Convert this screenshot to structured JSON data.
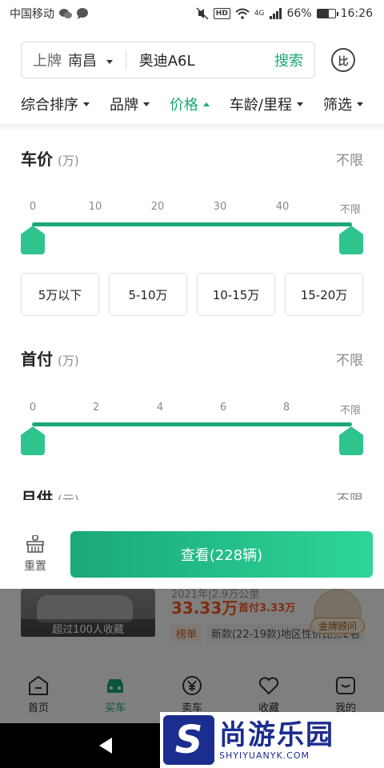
{
  "status_bar": {
    "carrier": "中国移动",
    "hd": "HD",
    "network": "4G",
    "battery": "66%",
    "battery_level": 0.66,
    "time": "16:26"
  },
  "search": {
    "plate_label": "上牌",
    "city": "南昌",
    "query": "奥迪A6L",
    "button": "搜索",
    "compare_icon_text": "比"
  },
  "filters": [
    {
      "label": "综合排序"
    },
    {
      "label": "品牌"
    },
    {
      "label": "价格"
    },
    {
      "label": "车龄/里程"
    },
    {
      "label": "筛选"
    }
  ],
  "price_section": {
    "title": "车价",
    "unit": "(万)",
    "value": "不限",
    "ticks": [
      "0",
      "10",
      "20",
      "30",
      "40",
      "不限"
    ],
    "range": [
      0,
      "不限"
    ],
    "chips": [
      "5万以下",
      "5-10万",
      "10-15万",
      "15-20万"
    ]
  },
  "downpayment_section": {
    "title": "首付",
    "unit": "(万)",
    "value": "不限",
    "ticks": [
      "0",
      "2",
      "4",
      "6",
      "8",
      "不限"
    ],
    "range": [
      0,
      "不限"
    ]
  },
  "monthly_section": {
    "title": "月供",
    "unit": "(元)",
    "value": "不限"
  },
  "actions": {
    "reset": "重置",
    "view": "查看(228辆)"
  },
  "listing": {
    "fav_count": "超过100人收藏",
    "sub": "2021年|2.9万公里",
    "price": "33.33万",
    "down_payment": "首付3.33万",
    "rank_tag": "榜单",
    "rank_text": "新款(22-19款)地区性价比第2名",
    "advisor": "金牌顾问"
  },
  "tabbar": [
    {
      "label": "首页",
      "icon": "home-icon"
    },
    {
      "label": "买车",
      "icon": "car-icon"
    },
    {
      "label": "卖车",
      "icon": "yuan-icon"
    },
    {
      "label": "收藏",
      "icon": "heart-icon"
    },
    {
      "label": "我的",
      "icon": "profile-icon"
    }
  ],
  "watermark": {
    "logo": "S",
    "cn": "尚游乐园",
    "en": "SHYIYUANYK.COM"
  }
}
